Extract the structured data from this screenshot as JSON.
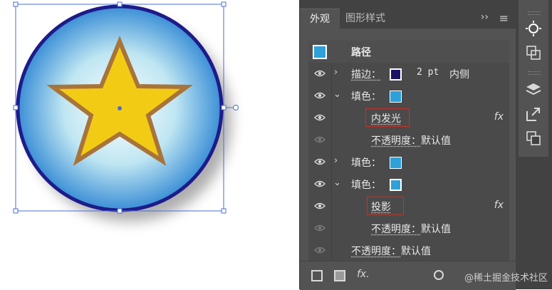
{
  "tabs": {
    "active": "外观",
    "inactive": "图形样式",
    "more": "››",
    "menu": "≡"
  },
  "appearance": {
    "object_type": "路径",
    "stroke": {
      "label": "描边：",
      "weight": "2 pt",
      "align": "内侧"
    },
    "fill_1": {
      "label": "填色："
    },
    "effect_1": {
      "name": "内发光",
      "fx": "fx"
    },
    "opacity_1": {
      "label": "不透明度：",
      "value": "默认值"
    },
    "fill_2": {
      "label": "填色："
    },
    "fill_3": {
      "label": "填色："
    },
    "effect_2": {
      "name": "投影",
      "fx": "fx"
    },
    "opacity_2": {
      "label": "不透明度：",
      "value": "默认值"
    },
    "opacity_main": {
      "label": "不透明度：",
      "value": "默认值"
    }
  },
  "bottom_bar": {
    "fx": "fx."
  },
  "watermark": "@稀土掘金技术社区",
  "colors": {
    "panel_bg": "#535353",
    "row_bg": "#4a4a4a",
    "fill_swatch": "#2fa0d8",
    "stroke_swatch": "#1a1466",
    "highlight_box": "#c9302c",
    "star_fill": "#f2cc14",
    "star_stroke": "#a8743a",
    "circle_stroke": "#1e1b8a",
    "selection": "#4a6cd4"
  },
  "icons": [
    "eye-icon",
    "chevron-right-icon",
    "chevron-down-icon",
    "fx-icon",
    "square-icon",
    "layers-icon",
    "export-icon",
    "sun-icon",
    "crop-icon",
    "clear-appearance-icon",
    "duplicate-icon"
  ]
}
